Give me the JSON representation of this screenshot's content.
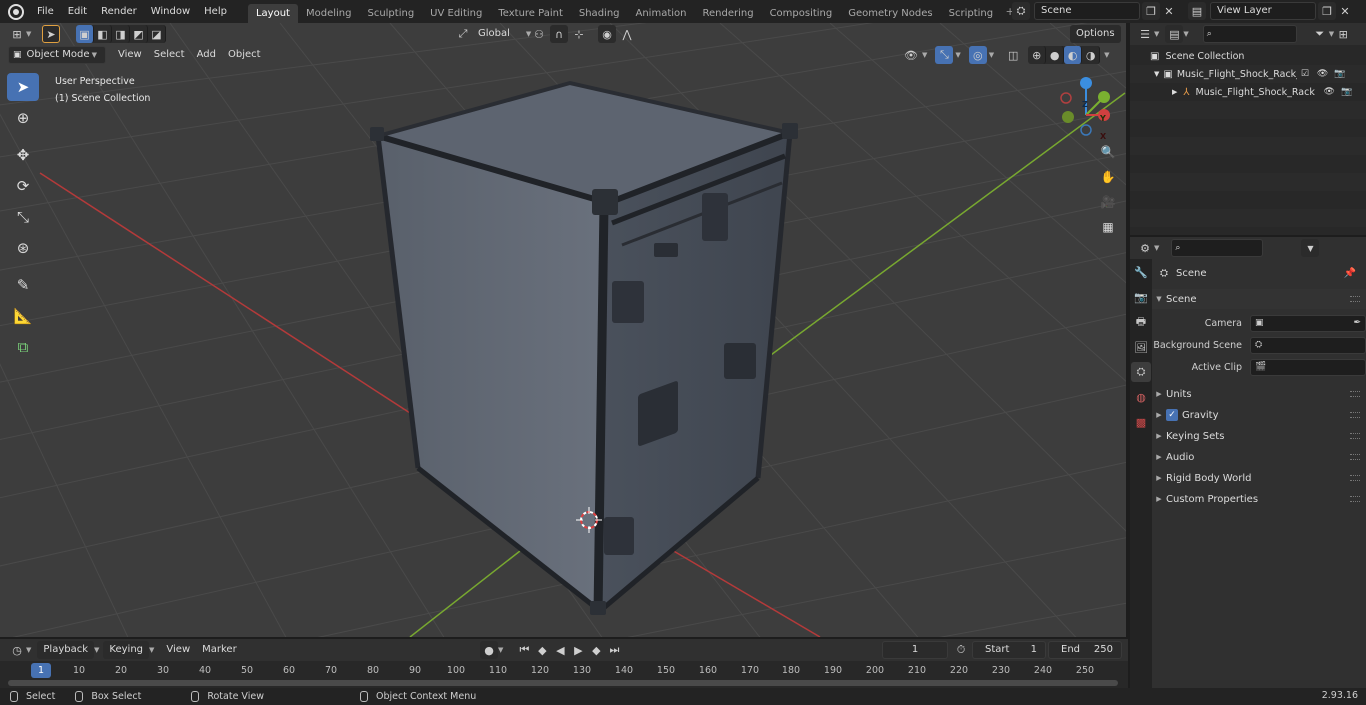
{
  "menu": {
    "items": [
      "File",
      "Edit",
      "Render",
      "Window",
      "Help"
    ]
  },
  "workspaces": {
    "tabs": [
      "Layout",
      "Modeling",
      "Sculpting",
      "UV Editing",
      "Texture Paint",
      "Shading",
      "Animation",
      "Rendering",
      "Compositing",
      "Geometry Nodes",
      "Scripting"
    ],
    "active": "Layout",
    "add_icon": "plus-icon"
  },
  "scene_selector": {
    "value": "Scene"
  },
  "view_layer_selector": {
    "value": "View Layer"
  },
  "viewport": {
    "mode": "Object Mode",
    "menus": [
      "View",
      "Select",
      "Add",
      "Object"
    ],
    "transform_orientation": "Global",
    "options_label": "Options",
    "perspective_label": "User Perspective",
    "collection_label": "(1) Scene Collection",
    "gizmo_axes": {
      "x": "X",
      "y": "Y",
      "z": "Z"
    },
    "colors": {
      "x_axis": "#d04040",
      "y_axis": "#7ab030",
      "z_axis": "#3b8ee0",
      "active": "#4772b3"
    }
  },
  "tools": [
    "select-box-tool",
    "cursor-tool",
    "move-tool",
    "rotate-tool",
    "scale-tool",
    "transform-tool",
    "annotate-tool",
    "measure-tool",
    "add-cube-tool"
  ],
  "timeline": {
    "menus": [
      "Playback",
      "Keying",
      "View",
      "Marker"
    ],
    "current_frame": "1",
    "start_label": "Start",
    "start_value": "1",
    "end_label": "End",
    "end_value": "250",
    "ruler_current": "1",
    "ruler_ticks": [
      "10",
      "20",
      "30",
      "40",
      "50",
      "60",
      "70",
      "80",
      "90",
      "100",
      "110",
      "120",
      "130",
      "140",
      "150",
      "160",
      "170",
      "180",
      "190",
      "200",
      "210",
      "220",
      "230",
      "240",
      "250"
    ]
  },
  "statusbar": {
    "select": "Select",
    "box_select": "Box Select",
    "rotate_view": "Rotate View",
    "context_menu": "Object Context Menu",
    "version": "2.93.16"
  },
  "outliner": {
    "root": "Scene Collection",
    "collection": "Music_Flight_Shock_Rack_Ca",
    "object": "Music_Flight_Shock_Rack"
  },
  "properties": {
    "context_title": "Scene",
    "panel_scene": "Scene",
    "camera_label": "Camera",
    "background_scene_label": "Background Scene",
    "active_clip_label": "Active Clip",
    "panels": [
      "Units",
      "Gravity",
      "Keying Sets",
      "Audio",
      "Rigid Body World",
      "Custom Properties"
    ]
  }
}
